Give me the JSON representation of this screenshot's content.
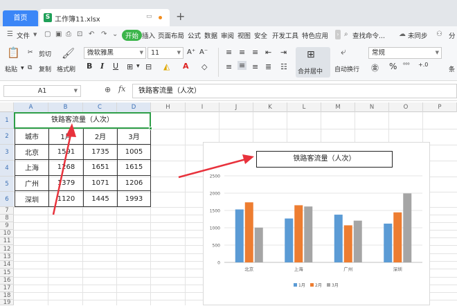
{
  "tabs": {
    "home": "首页",
    "doc_name": "工作簿11.xlsx",
    "doc_icon_letter": "S",
    "new_tab": "+"
  },
  "menu": {
    "file": "文件",
    "start": "开始",
    "items": [
      "插入",
      "页面布局",
      "公式",
      "数据",
      "审阅",
      "视图",
      "安全",
      "开发工具",
      "特色应用"
    ],
    "search": "查找命令...",
    "sync": "未同步",
    "share": "分"
  },
  "ribbon": {
    "paste": "粘贴",
    "cut": "剪切",
    "copy": "复制",
    "format_painter": "格式刷",
    "font_name": "微软雅黑",
    "font_size": "11",
    "merge": "合并居中",
    "wrap": "自动换行",
    "number_format": "常规",
    "percent": "%",
    "dec_inc": "⁰⁰⁰",
    "dec_dec": "+.0",
    "extra": "条"
  },
  "formula_bar": {
    "cell_ref": "A1",
    "fx": "fx",
    "content": "铁路客流量（人次）"
  },
  "columns": [
    "A",
    "B",
    "C",
    "D",
    "H",
    "I",
    "J",
    "K",
    "L",
    "M",
    "N",
    "O",
    "P"
  ],
  "rows": [
    "1",
    "2",
    "3",
    "4",
    "5",
    "6",
    "7",
    "8",
    "9",
    "10",
    "11",
    "12",
    "13",
    "14",
    "15",
    "16",
    "17",
    "18",
    "19"
  ],
  "sheet": {
    "title": "铁路客流量（人次）",
    "header": [
      "城市",
      "1月",
      "2月",
      "3月"
    ],
    "data": [
      [
        "北京",
        "1591",
        "1735",
        "1005"
      ],
      [
        "上海",
        "1268",
        "1651",
        "1615"
      ],
      [
        "广州",
        "1379",
        "1071",
        "1206"
      ],
      [
        "深圳",
        "1120",
        "1445",
        "1993"
      ]
    ]
  },
  "chart_data": {
    "type": "bar",
    "title": "铁路客流量（人次）",
    "categories": [
      "北京",
      "上海",
      "广州",
      "深圳"
    ],
    "series": [
      {
        "name": "1月",
        "values": [
          1530,
          1268,
          1379,
          1120
        ],
        "color": "#5b9bd5"
      },
      {
        "name": "2月",
        "values": [
          1735,
          1651,
          1071,
          1445
        ],
        "color": "#ed7d31"
      },
      {
        "name": "3月",
        "values": [
          1005,
          1615,
          1206,
          1993
        ],
        "color": "#a5a5a5"
      }
    ],
    "yticks": [
      "2500",
      "2000",
      "1500",
      "1000",
      "500",
      "0"
    ],
    "ylim": [
      0,
      2500
    ],
    "legend_position": "bottom",
    "grid": true
  },
  "colors": {
    "accent": "#3b86f7",
    "selection": "#2e9e48",
    "arrow": "#e8323c"
  }
}
